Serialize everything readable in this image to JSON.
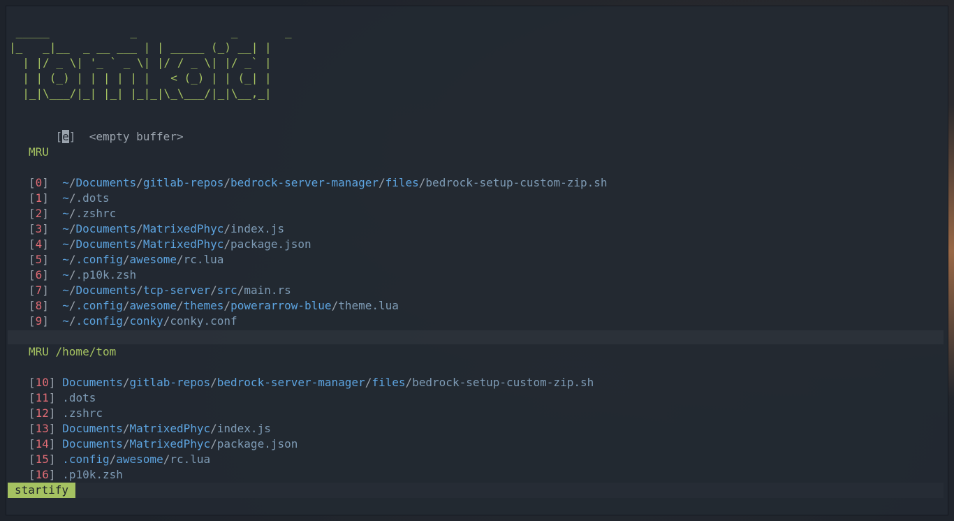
{
  "banner": " _____            _              _       _ \n|_   _|__  _ __ ___ | | _____ (_) __| |\n  | |/ _ \\| '_ ` _ \\| |/ / _ \\| |/ _` |\n  | | (_) | | | | | |   < (_) | | (_| |\n  |_|\\___/|_| |_| |_|_|\\_\\___/|_|\\__,_|",
  "empty_entry": {
    "open": "[",
    "key": "e",
    "close": "]",
    "label": "<empty buffer>"
  },
  "sections": {
    "mru_title": "MRU",
    "mru_cwd_title": "MRU /home/tom"
  },
  "mru": [
    {
      "index": "0",
      "segments": [
        {
          "t": "dir",
          "v": "~"
        },
        {
          "t": "sep",
          "v": "/"
        },
        {
          "t": "dir",
          "v": "Documents"
        },
        {
          "t": "sep",
          "v": "/"
        },
        {
          "t": "dir",
          "v": "gitlab-repos"
        },
        {
          "t": "sep",
          "v": "/"
        },
        {
          "t": "dir",
          "v": "bedrock-server-manager"
        },
        {
          "t": "sep",
          "v": "/"
        },
        {
          "t": "dir",
          "v": "files"
        },
        {
          "t": "sep",
          "v": "/"
        },
        {
          "t": "file",
          "v": "bedrock-setup-custom-zip.sh"
        }
      ]
    },
    {
      "index": "1",
      "segments": [
        {
          "t": "dir",
          "v": "~"
        },
        {
          "t": "sep",
          "v": "/"
        },
        {
          "t": "file",
          "v": ".dots"
        }
      ]
    },
    {
      "index": "2",
      "segments": [
        {
          "t": "dir",
          "v": "~"
        },
        {
          "t": "sep",
          "v": "/"
        },
        {
          "t": "file",
          "v": ".zshrc"
        }
      ]
    },
    {
      "index": "3",
      "segments": [
        {
          "t": "dir",
          "v": "~"
        },
        {
          "t": "sep",
          "v": "/"
        },
        {
          "t": "dir",
          "v": "Documents"
        },
        {
          "t": "sep",
          "v": "/"
        },
        {
          "t": "dir",
          "v": "MatrixedPhyc"
        },
        {
          "t": "sep",
          "v": "/"
        },
        {
          "t": "file",
          "v": "index.js"
        }
      ]
    },
    {
      "index": "4",
      "segments": [
        {
          "t": "dir",
          "v": "~"
        },
        {
          "t": "sep",
          "v": "/"
        },
        {
          "t": "dir",
          "v": "Documents"
        },
        {
          "t": "sep",
          "v": "/"
        },
        {
          "t": "dir",
          "v": "MatrixedPhyc"
        },
        {
          "t": "sep",
          "v": "/"
        },
        {
          "t": "file",
          "v": "package.json"
        }
      ]
    },
    {
      "index": "5",
      "segments": [
        {
          "t": "dir",
          "v": "~"
        },
        {
          "t": "sep",
          "v": "/"
        },
        {
          "t": "dir",
          "v": ".config"
        },
        {
          "t": "sep",
          "v": "/"
        },
        {
          "t": "dir",
          "v": "awesome"
        },
        {
          "t": "sep",
          "v": "/"
        },
        {
          "t": "file",
          "v": "rc.lua"
        }
      ]
    },
    {
      "index": "6",
      "segments": [
        {
          "t": "dir",
          "v": "~"
        },
        {
          "t": "sep",
          "v": "/"
        },
        {
          "t": "file",
          "v": ".p10k.zsh"
        }
      ]
    },
    {
      "index": "7",
      "segments": [
        {
          "t": "dir",
          "v": "~"
        },
        {
          "t": "sep",
          "v": "/"
        },
        {
          "t": "dir",
          "v": "Documents"
        },
        {
          "t": "sep",
          "v": "/"
        },
        {
          "t": "dir",
          "v": "tcp-server"
        },
        {
          "t": "sep",
          "v": "/"
        },
        {
          "t": "dir",
          "v": "src"
        },
        {
          "t": "sep",
          "v": "/"
        },
        {
          "t": "file",
          "v": "main.rs"
        }
      ]
    },
    {
      "index": "8",
      "segments": [
        {
          "t": "dir",
          "v": "~"
        },
        {
          "t": "sep",
          "v": "/"
        },
        {
          "t": "dir",
          "v": ".config"
        },
        {
          "t": "sep",
          "v": "/"
        },
        {
          "t": "dir",
          "v": "awesome"
        },
        {
          "t": "sep",
          "v": "/"
        },
        {
          "t": "dir",
          "v": "themes"
        },
        {
          "t": "sep",
          "v": "/"
        },
        {
          "t": "dir",
          "v": "powerarrow-blue"
        },
        {
          "t": "sep",
          "v": "/"
        },
        {
          "t": "file",
          "v": "theme.lua"
        }
      ]
    },
    {
      "index": "9",
      "segments": [
        {
          "t": "dir",
          "v": "~"
        },
        {
          "t": "sep",
          "v": "/"
        },
        {
          "t": "dir",
          "v": ".config"
        },
        {
          "t": "sep",
          "v": "/"
        },
        {
          "t": "dir",
          "v": "conky"
        },
        {
          "t": "sep",
          "v": "/"
        },
        {
          "t": "file",
          "v": "conky.conf"
        }
      ]
    }
  ],
  "mru_cwd": [
    {
      "index": "10",
      "segments": [
        {
          "t": "dir",
          "v": "Documents"
        },
        {
          "t": "sep",
          "v": "/"
        },
        {
          "t": "dir",
          "v": "gitlab-repos"
        },
        {
          "t": "sep",
          "v": "/"
        },
        {
          "t": "dir",
          "v": "bedrock-server-manager"
        },
        {
          "t": "sep",
          "v": "/"
        },
        {
          "t": "dir",
          "v": "files"
        },
        {
          "t": "sep",
          "v": "/"
        },
        {
          "t": "file",
          "v": "bedrock-setup-custom-zip.sh"
        }
      ]
    },
    {
      "index": "11",
      "segments": [
        {
          "t": "file",
          "v": ".dots"
        }
      ]
    },
    {
      "index": "12",
      "segments": [
        {
          "t": "file",
          "v": ".zshrc"
        }
      ]
    },
    {
      "index": "13",
      "segments": [
        {
          "t": "dir",
          "v": "Documents"
        },
        {
          "t": "sep",
          "v": "/"
        },
        {
          "t": "dir",
          "v": "MatrixedPhyc"
        },
        {
          "t": "sep",
          "v": "/"
        },
        {
          "t": "file",
          "v": "index.js"
        }
      ]
    },
    {
      "index": "14",
      "segments": [
        {
          "t": "dir",
          "v": "Documents"
        },
        {
          "t": "sep",
          "v": "/"
        },
        {
          "t": "dir",
          "v": "MatrixedPhyc"
        },
        {
          "t": "sep",
          "v": "/"
        },
        {
          "t": "file",
          "v": "package.json"
        }
      ]
    },
    {
      "index": "15",
      "segments": [
        {
          "t": "dir",
          "v": ".config"
        },
        {
          "t": "sep",
          "v": "/"
        },
        {
          "t": "dir",
          "v": "awesome"
        },
        {
          "t": "sep",
          "v": "/"
        },
        {
          "t": "file",
          "v": "rc.lua"
        }
      ]
    },
    {
      "index": "16",
      "segments": [
        {
          "t": "file",
          "v": ".p10k.zsh"
        }
      ]
    }
  ],
  "statusline": {
    "mode": "startify"
  },
  "colors": {
    "accent_green": "#a5c261",
    "index_red": "#e06c75",
    "dir_blue": "#5da4e0",
    "file_gray_blue": "#7e9bb5",
    "background": "#232932"
  }
}
